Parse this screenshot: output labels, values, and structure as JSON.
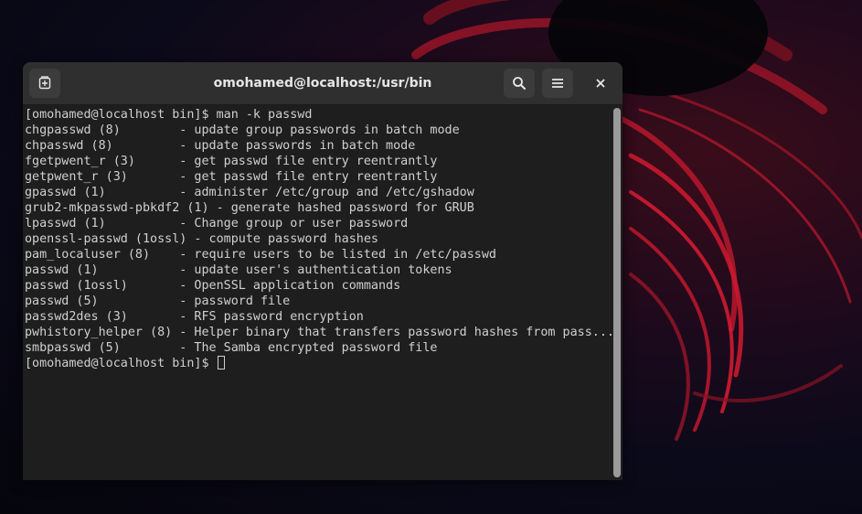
{
  "window": {
    "title": "omohamed@localhost:/usr/bin",
    "new_tab_icon": "new-tab-icon",
    "search_icon": "search-icon",
    "menu_icon": "hamburger-menu-icon",
    "close_icon": "close-icon"
  },
  "terminal": {
    "lines": [
      "[omohamed@localhost bin]$ man -k passwd",
      "chgpasswd (8)        - update group passwords in batch mode",
      "chpasswd (8)         - update passwords in batch mode",
      "fgetpwent_r (3)      - get passwd file entry reentrantly",
      "getpwent_r (3)       - get passwd file entry reentrantly",
      "gpasswd (1)          - administer /etc/group and /etc/gshadow",
      "grub2-mkpasswd-pbkdf2 (1) - generate hashed password for GRUB",
      "lpasswd (1)          - Change group or user password",
      "openssl-passwd (1ossl) - compute password hashes",
      "pam_localuser (8)    - require users to be listed in /etc/passwd",
      "passwd (1)           - update user's authentication tokens",
      "passwd (1ossl)       - OpenSSL application commands",
      "passwd (5)           - password file",
      "passwd2des (3)       - RFS password encryption",
      "pwhistory_helper (8) - Helper binary that transfers password hashes from pass...",
      "smbpasswd (5)        - The Samba encrypted password file"
    ],
    "prompt": "[omohamed@localhost bin]$ "
  },
  "colors": {
    "terminal_bg": "#1e1e1e",
    "terminal_fg": "#d0d0d0",
    "headerbar_bg": "#2f2f2f",
    "button_bg": "#3c3c3c"
  }
}
